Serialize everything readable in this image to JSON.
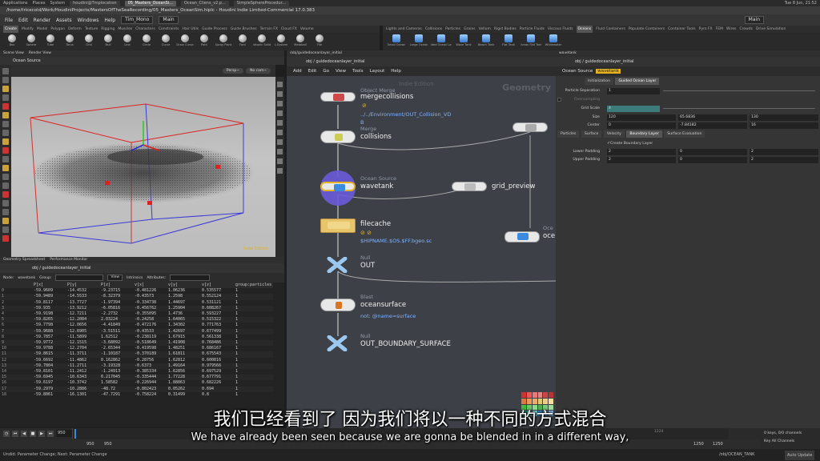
{
  "os_bar": {
    "items": [
      "Applications",
      "Places",
      "System"
    ],
    "tasks": [
      "houdini@Tmplocation",
      "05_Masters_OceanSi...",
      "Ocean_Cliens_v2.p...",
      "SimpleSphereProcedur..."
    ],
    "clock": "Tue 8 Jun, 21:52"
  },
  "window_title": "/home/tricecold/Work/HoudiniProjects/MastersOfTheSeaRecording/05_Masters_OceanSim.hiplc - Houdini Indie Limited-Commercial 17.0.383",
  "menu": [
    "File",
    "Edit",
    "Render",
    "Assets",
    "Windows",
    "Help"
  ],
  "desktop_combo": "Tim_Mono",
  "build_label": "Main",
  "right_desktop_combo": "Main",
  "shelf_tabs_left": [
    "Create",
    "Modify",
    "Model",
    "Polygon",
    "Deform",
    "Texture",
    "Rigging",
    "Muscles",
    "Characters",
    "Constraints",
    "Hair Utils",
    "Guide Process",
    "Guide Brushes",
    "Terrain FX",
    "Cloud FX",
    "Volume"
  ],
  "shelf_tools_left": [
    "Box",
    "Sphere",
    "Tube",
    "Torus",
    "Grid",
    "Null",
    "Line",
    "Circle",
    "Curve",
    "Draw Curve",
    "Path",
    "Spray Paint",
    "Font",
    "Platonic Solids",
    "L-System",
    "Metaball",
    "File"
  ],
  "shelf_tabs_right": [
    "Lights and Cameras",
    "Collisions",
    "Particles",
    "Grains",
    "Vellum",
    "Rigid Bodies",
    "Particle Fluids",
    "Viscous Fluids",
    "Oceans",
    "Fluid Containers",
    "Populate Containers",
    "Container Tools",
    "Pyro FX",
    "FEM",
    "Wires",
    "Crowds",
    "Drive Simulation"
  ],
  "shelf_tools_right": [
    "Small Ocean",
    "Large Ocean",
    "Guided Ocean Layer",
    "Wave Tank",
    "Beach Tank",
    "Flat Tank",
    "Ocean Flat Tank",
    "Whitewater"
  ],
  "viewport": {
    "tabs": [
      "Scene View",
      "Render View"
    ],
    "node_label": "Ocean Source",
    "persp": "Persp~",
    "cam": "No cam~",
    "edition": "Indie Edition"
  },
  "spreadsheet": {
    "tabs": [
      "Geometry Spreadsheet",
      "Performance Monitor"
    ],
    "path": "obj / guidedoceanlayer_initial",
    "node_label": "Node:",
    "node": "wavetank",
    "group_label": "Group:",
    "view": "View",
    "intrinsics": "Intrinsics",
    "attributes": "Attributes:",
    "columns": [
      "",
      "P[x]",
      "P[y]",
      "P[z]",
      "v[x]",
      "v[y]",
      "v[z]",
      "group:particles"
    ],
    "rows": [
      [
        "0",
        "-59.9609",
        "-14.4532",
        "-9.23715",
        "-0.481226",
        "1.06236",
        "0.535577",
        "1"
      ],
      [
        "1",
        "-59.9489",
        "-14.5533",
        "-8.32379",
        "-0.43573",
        "1.2598",
        "0.552124",
        "1"
      ],
      [
        "2",
        "-59.8117",
        "-13.7727",
        "-1.97394",
        "-0.334738",
        "1.44697",
        "0.531121",
        "1"
      ],
      [
        "3",
        "-59.935",
        "-13.9212",
        "-6.05816",
        "-0.456762",
        "1.25904",
        "0.608267",
        "1"
      ],
      [
        "4",
        "-59.9198",
        "-12.7211",
        "-2.2732",
        "-0.355095",
        "1.4736",
        "0.593227",
        "1"
      ],
      [
        "5",
        "-59.8265",
        "-12.2084",
        "2.03224",
        "-0.24258",
        "1.64065",
        "0.515322",
        "1"
      ],
      [
        "6",
        "-59.7798",
        "-12.0656",
        "-4.41849",
        "-0.472176",
        "1.34302",
        "0.771763",
        "1"
      ],
      [
        "7",
        "-59.9688",
        "-12.6905",
        "-3.51511",
        "-0.43533",
        "1.42697",
        "0.677499",
        "1"
      ],
      [
        "8",
        "-59.7857",
        "-11.5899",
        "1.62512",
        "-0.238119",
        "1.67915",
        "0.561338",
        "1"
      ],
      [
        "9",
        "-59.9772",
        "-12.1515",
        "-3.68092",
        "-0.518649",
        "1.41908",
        "0.768486",
        "1"
      ],
      [
        "10",
        "-59.9788",
        "-12.2704",
        "-2.65344",
        "-0.419598",
        "1.48251",
        "0.686167",
        "1"
      ],
      [
        "11",
        "-59.8615",
        "-11.3711",
        "-1.10187",
        "-0.370189",
        "1.61811",
        "0.675543",
        "1"
      ],
      [
        "12",
        "-59.6692",
        "-11.4862",
        "0.162862",
        "-0.28756",
        "1.62812",
        "0.600816",
        "1"
      ],
      [
        "13",
        "-59.7804",
        "-11.2711",
        "-3.19328",
        "-0.6373",
        "1.49164",
        "0.979566",
        "1"
      ],
      [
        "14",
        "-59.8101",
        "-11.2412",
        "-1.24913",
        "-0.385334",
        "1.62856",
        "0.697529",
        "1"
      ],
      [
        "15",
        "-59.6945",
        "-10.6343",
        "0.217045",
        "-0.335444",
        "1.77228",
        "0.677791",
        "1"
      ],
      [
        "16",
        "-59.6197",
        "-10.3742",
        "1.58582",
        "-0.226944",
        "1.88863",
        "0.682226",
        "1"
      ],
      [
        "17",
        "-59.2979",
        "-10.2886",
        "-48.72",
        "-0.802423",
        "0.05262",
        "0.694",
        "1"
      ],
      [
        "18",
        "-59.8061",
        "-16.1301",
        "-47.7291",
        "-0.758224",
        "0.31499",
        "0.8",
        "1"
      ]
    ]
  },
  "network": {
    "tabs": [
      "/obj/guidedoceanlayer_initial"
    ],
    "path": "obj / guidedoceanlayer_initial",
    "menu": [
      "Add",
      "Edit",
      "Go",
      "View",
      "Tools",
      "Layout",
      "Help"
    ],
    "watermark": "Geometry",
    "edition": "Indie Edition",
    "nodes": {
      "mergecollisions": {
        "type": "Object Merge",
        "name": "mergecollisions",
        "sub1": "../../Environment/OUT_Collision_VD",
        "sub2": "B"
      },
      "collisions": {
        "type": "Merge",
        "name": "collisions"
      },
      "wavetank": {
        "type": "Ocean Source",
        "name": "wavetank"
      },
      "grid_preview": {
        "name": "grid_preview"
      },
      "filecache": {
        "name": "filecache",
        "sub": "$HIPNAME.$OS.$FF.bgeo.sc"
      },
      "out": {
        "type": "Null",
        "name": "OUT"
      },
      "oceansurface": {
        "type": "Blast",
        "name": "oceansurface",
        "sub": "not: @name=surface"
      },
      "out_boundary": {
        "type": "Null",
        "name": "OUT_BOUNDARY_SURFACE"
      },
      "oce": {
        "type": "Oce",
        "name": "oce"
      }
    }
  },
  "params": {
    "tabs_top": "wavetank",
    "path": "obj / guidedoceanlayer_initial",
    "node_type": "Ocean Source",
    "node_name": "wavetank",
    "sub_tabs": [
      "Initialization",
      "Guided Ocean Layer"
    ],
    "fields": [
      {
        "label": "Particle Separation",
        "v1": "1"
      },
      {
        "label": "Oversampling",
        "v1": ""
      },
      {
        "label": "Grid Scale",
        "v1": "4"
      },
      {
        "label": "Size",
        "v1": "120",
        "v2": "65.6836",
        "v3": "130"
      },
      {
        "label": "Center",
        "v1": "0",
        "v2": "-7.84182",
        "v3": "16"
      }
    ],
    "tabs2": [
      "Particles",
      "Surface",
      "Velocity",
      "Boundary Layer",
      "Surface Evaluation"
    ],
    "checkbox": "Create Boundary Layer",
    "padding": [
      {
        "label": "Lower Padding",
        "v1": "2",
        "v2": "0",
        "v3": "2"
      },
      {
        "label": "Upper Padding",
        "v1": "2",
        "v2": "0",
        "v3": "2"
      }
    ]
  },
  "timeline": {
    "frame": "950",
    "start": "950",
    "end": "950",
    "range_end": "1250",
    "range_end2": "1250",
    "tick": "1224",
    "keys": "0 keys, 0/0 channels",
    "key_all": "Key All Channels",
    "auto_update": "Auto Update",
    "path_status": "/obj/OCEAN_TANK"
  },
  "status": "Undid: Parameter Change; Next: Parameter Change",
  "subtitle_cn": "我们已经看到了 因为我们将以一种不同的方式混合",
  "subtitle_en": "We have already been seen because we are gonna be blended in in a different way,"
}
